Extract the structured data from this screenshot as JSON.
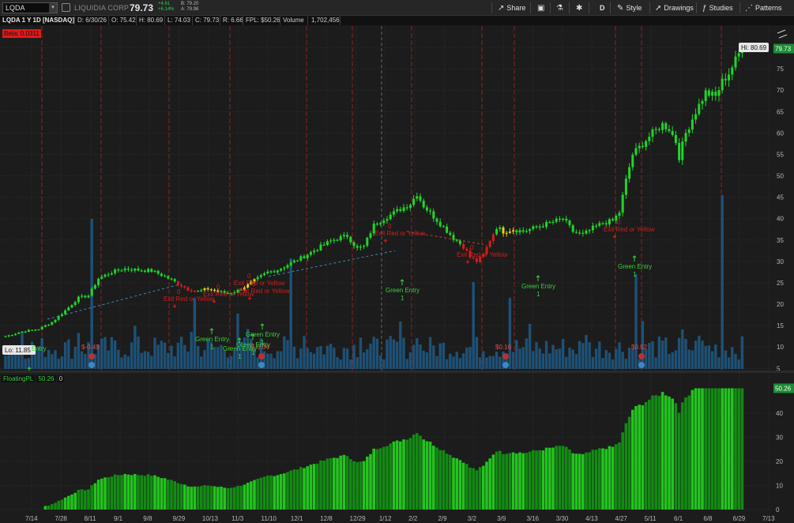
{
  "toolbar": {
    "symbol": "LQDA",
    "company": "LIQUIDIA CORP",
    "last": "79.73",
    "change": "+4.61",
    "change_pct": "+6.14%",
    "bid": "B: 79.20",
    "ask": "A: 79.98",
    "share": "Share",
    "style": "Style",
    "drawings": "Drawings",
    "studies": "Studies",
    "patterns": "Patterns",
    "aggregation": "D"
  },
  "infobar": {
    "title": "LQDA 1 Y 1D [NASDAQ]",
    "date": "D: 6/30/26",
    "open": "O: 75.42",
    "high": "H: 80.69",
    "low": "L: 74.03",
    "close": "C: 79.73",
    "range": "R: 6.66",
    "fpl": "FPL: $50.26",
    "volume_label": "Volume",
    "volume": "1,702,456"
  },
  "beta_badge": "Beta: 0.0311",
  "sub_pane": {
    "study": "FloatingPL",
    "value": "50.26",
    "extra": "0"
  },
  "colors": {
    "up": "#1fd62a",
    "down": "#d41b1b",
    "neutral": "#e3d21a",
    "volume": "#1f5a86",
    "signal_red": "#d11c1c",
    "signal_green": "#3ad13a",
    "grid": "#2e2e2e",
    "event_line": "#8f1f1f",
    "price_tag": "#1c8b36"
  },
  "chart_data": [
    {
      "type": "line",
      "name_note": "price",
      "ylim": [
        4.5,
        85
      ],
      "y_ticks": [
        5,
        10,
        15,
        20,
        25,
        30,
        35,
        40,
        45,
        50,
        55,
        60,
        65,
        70,
        75,
        80
      ],
      "x_ticks": [
        "7/14",
        "7/28",
        "8/11",
        "9/1",
        "9/8",
        "9/29",
        "10/13",
        "11/3",
        "11/10",
        "12/1",
        "12/8",
        "12/29",
        "1/12",
        "2/2",
        "2/9",
        "3/2",
        "3/9",
        "3/16",
        "3/30",
        "4/13",
        "4/27",
        "5/11",
        "6/1",
        "6/8",
        "6/29",
        "7/13"
      ],
      "price_anchor": [
        [
          0,
          12.5
        ],
        [
          5,
          13.6
        ],
        [
          10,
          14.2
        ],
        [
          14,
          15.8
        ],
        [
          18,
          18.5
        ],
        [
          22,
          21.5
        ],
        [
          25,
          22.0
        ],
        [
          28,
          26.0
        ],
        [
          32,
          27.5
        ],
        [
          36,
          28.3
        ],
        [
          40,
          28.0
        ],
        [
          44,
          27.8
        ],
        [
          48,
          26.5
        ],
        [
          52,
          24.8
        ],
        [
          55,
          23.5
        ],
        [
          58,
          23.0
        ],
        [
          61,
          23.6
        ],
        [
          64,
          23.0
        ],
        [
          67,
          22.5
        ],
        [
          70,
          23.2
        ],
        [
          73,
          24.5
        ],
        [
          76,
          26.0
        ],
        [
          79,
          27.5
        ],
        [
          82,
          28.0
        ],
        [
          86,
          29.6
        ],
        [
          90,
          31.2
        ],
        [
          94,
          33.0
        ],
        [
          98,
          34.8
        ],
        [
          101,
          35.6
        ],
        [
          103,
          36.0
        ],
        [
          106,
          33.0
        ],
        [
          108,
          33.5
        ],
        [
          111,
          38.5
        ],
        [
          114,
          40.0
        ],
        [
          118,
          41.8
        ],
        [
          122,
          43.5
        ],
        [
          124,
          45.8
        ],
        [
          126,
          43.0
        ],
        [
          129,
          40.5
        ],
        [
          132,
          38.0
        ],
        [
          135,
          35.5
        ],
        [
          138,
          33.5
        ],
        [
          140,
          31.0
        ],
        [
          142,
          30.0
        ],
        [
          144,
          31.5
        ],
        [
          146,
          35.0
        ],
        [
          148,
          38.0
        ],
        [
          150,
          37.0
        ],
        [
          153,
          37.5
        ],
        [
          156,
          37.0
        ],
        [
          160,
          38.0
        ],
        [
          164,
          39.0
        ],
        [
          168,
          40.0
        ],
        [
          171,
          37.0
        ],
        [
          174,
          36.2
        ],
        [
          177,
          37.8
        ],
        [
          180,
          39.0
        ],
        [
          183,
          39.5
        ],
        [
          185,
          41.5
        ],
        [
          187,
          49.0
        ],
        [
          189,
          55.0
        ],
        [
          192,
          57.5
        ],
        [
          195,
          60.0
        ],
        [
          198,
          62.0
        ],
        [
          200,
          61.0
        ],
        [
          202,
          58.0
        ],
        [
          203,
          54.5
        ],
        [
          205,
          60.0
        ],
        [
          208,
          65.0
        ],
        [
          211,
          69.5
        ],
        [
          214,
          68.5
        ],
        [
          216,
          72.0
        ],
        [
          218,
          74.0
        ],
        [
          220,
          77.0
        ],
        [
          222,
          80.0
        ]
      ],
      "last_price": "79.73",
      "hi_label": "Hi: 80.69",
      "lo_label": "Lo: 11.85",
      "price_axis_tag": "79.73"
    },
    {
      "type": "bar",
      "name_note": "floating-pl",
      "ylim": [
        0,
        55
      ],
      "y_ticks": [
        0,
        10,
        20,
        30,
        40
      ],
      "value_tag": "50.26"
    }
  ],
  "signals": {
    "exits": [
      {
        "count": "0",
        "label": "Exit Red or Yellow"
      },
      {
        "count": "0",
        "label": "Exit Red or Yellow"
      },
      {
        "count": "0",
        "label": "Exit Red or Yellow"
      },
      {
        "count": "0",
        "label": "Exit Red or Yellow"
      },
      {
        "count": "0",
        "label": "Exit Red or Yellow"
      },
      {
        "count": "0",
        "label": "Exit Red or Yellow"
      },
      {
        "count": "0",
        "label": "Exit Red or Yellow"
      }
    ],
    "entries": [
      {
        "label": "Green Entry",
        "count": ""
      },
      {
        "label": "Green Entry",
        "count": "1"
      },
      {
        "label": "Green Entry",
        "count": "1"
      },
      {
        "label": "Green Entry",
        "count": "1"
      },
      {
        "label": "Green Entry",
        "count": "1"
      },
      {
        "label": "Green Entry",
        "count": "1"
      },
      {
        "label": "Green Entry",
        "count": "1"
      },
      {
        "label": "Green Entry",
        "count": "1"
      }
    ],
    "earnings": [
      "$-0.49",
      "$-0.04",
      "$0.16",
      "$0.52"
    ]
  }
}
